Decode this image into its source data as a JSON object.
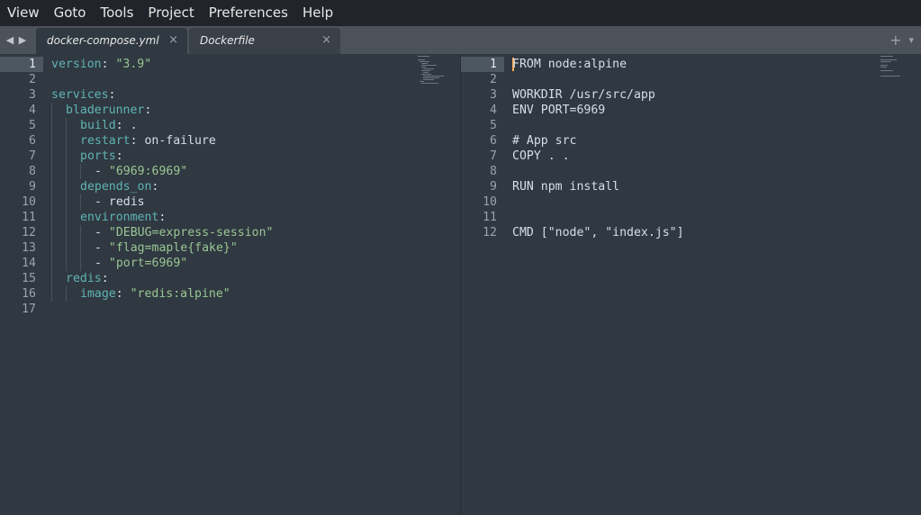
{
  "menu": [
    "View",
    "Goto",
    "Tools",
    "Project",
    "Preferences",
    "Help"
  ],
  "tabs": [
    {
      "label": "docker-compose.yml",
      "close": "×"
    },
    {
      "label": "Dockerfile",
      "close": "×"
    }
  ],
  "tabbar": {
    "add": "+",
    "more": "▾",
    "prev": "◀",
    "next": "▶"
  },
  "left_editor": {
    "file": "docker-compose.yml",
    "current_line": 1,
    "lines": [
      {
        "n": "1",
        "parts": [
          [
            "k",
            "version"
          ],
          [
            "p",
            ": "
          ],
          [
            "s",
            "\"3.9\""
          ]
        ],
        "indent": 0
      },
      {
        "n": "2",
        "parts": [],
        "indent": 0
      },
      {
        "n": "3",
        "parts": [
          [
            "k",
            "services"
          ],
          [
            "p",
            ":"
          ]
        ],
        "indent": 0
      },
      {
        "n": "4",
        "parts": [
          [
            "k",
            "bladerunner"
          ],
          [
            "p",
            ":"
          ]
        ],
        "indent": 1
      },
      {
        "n": "5",
        "parts": [
          [
            "k",
            "build"
          ],
          [
            "p",
            ": ."
          ]
        ],
        "indent": 2
      },
      {
        "n": "6",
        "parts": [
          [
            "k",
            "restart"
          ],
          [
            "p",
            ": on-failure"
          ]
        ],
        "indent": 2
      },
      {
        "n": "7",
        "parts": [
          [
            "k",
            "ports"
          ],
          [
            "p",
            ":"
          ]
        ],
        "indent": 2
      },
      {
        "n": "8",
        "parts": [
          [
            "p",
            "- "
          ],
          [
            "s",
            "\"6969:6969\""
          ]
        ],
        "indent": 3
      },
      {
        "n": "9",
        "parts": [
          [
            "k",
            "depends_on"
          ],
          [
            "p",
            ":"
          ]
        ],
        "indent": 2
      },
      {
        "n": "10",
        "parts": [
          [
            "p",
            "- redis"
          ]
        ],
        "indent": 3
      },
      {
        "n": "11",
        "parts": [
          [
            "k",
            "environment"
          ],
          [
            "p",
            ":"
          ]
        ],
        "indent": 2
      },
      {
        "n": "12",
        "parts": [
          [
            "p",
            "- "
          ],
          [
            "s",
            "\"DEBUG=express-session\""
          ]
        ],
        "indent": 3
      },
      {
        "n": "13",
        "parts": [
          [
            "p",
            "- "
          ],
          [
            "s",
            "\"flag=maple{fake}\""
          ]
        ],
        "indent": 3
      },
      {
        "n": "14",
        "parts": [
          [
            "p",
            "- "
          ],
          [
            "s",
            "\"port=6969\""
          ]
        ],
        "indent": 3
      },
      {
        "n": "15",
        "parts": [
          [
            "k",
            "redis"
          ],
          [
            "p",
            ":"
          ]
        ],
        "indent": 1
      },
      {
        "n": "16",
        "parts": [
          [
            "k",
            "image"
          ],
          [
            "p",
            ": "
          ],
          [
            "s",
            "\"redis:alpine\""
          ]
        ],
        "indent": 2
      },
      {
        "n": "17",
        "parts": [],
        "indent": 0
      }
    ]
  },
  "right_editor": {
    "file": "Dockerfile",
    "current_line": 1,
    "lines": [
      {
        "n": "1",
        "text": "FROM node:alpine"
      },
      {
        "n": "2",
        "text": ""
      },
      {
        "n": "3",
        "text": "WORKDIR /usr/src/app"
      },
      {
        "n": "4",
        "text": "ENV PORT=6969"
      },
      {
        "n": "5",
        "text": ""
      },
      {
        "n": "6",
        "text": "# App src"
      },
      {
        "n": "7",
        "text": "COPY . ."
      },
      {
        "n": "8",
        "text": ""
      },
      {
        "n": "9",
        "text": "RUN npm install"
      },
      {
        "n": "10",
        "text": ""
      },
      {
        "n": "11",
        "text": ""
      },
      {
        "n": "12",
        "text": "CMD [\"node\", \"index.js\"]"
      }
    ]
  }
}
